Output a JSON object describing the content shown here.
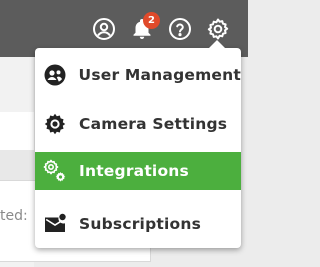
{
  "header": {
    "icons": {
      "account": "account-circle-icon",
      "notifications": "bell-icon",
      "help": "help-circle-icon",
      "settings": "gear-icon"
    },
    "notification_count": "2",
    "badge_color": "#e04a2b",
    "bar_color": "#5c5c5c"
  },
  "background": {
    "card_text": "ted:"
  },
  "settings_menu": {
    "items": [
      {
        "label": "User Management",
        "icon": "user-management-icon",
        "active": false
      },
      {
        "label": "Camera Settings",
        "icon": "camera-settings-gear-icon",
        "active": false
      },
      {
        "label": "Integrations",
        "icon": "integrations-gears-icon",
        "active": true
      },
      {
        "label": "Subscriptions",
        "icon": "mail-notification-icon",
        "active": false
      }
    ],
    "active_color": "#4caf3e"
  }
}
